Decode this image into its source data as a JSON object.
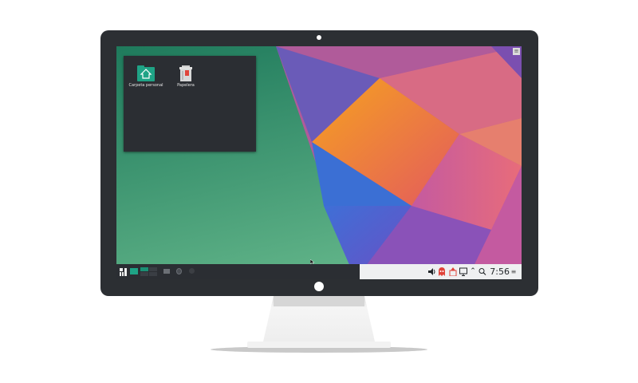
{
  "desktop": {
    "icons": [
      {
        "name": "home-folder-icon",
        "label": "Carpeta personal"
      },
      {
        "name": "trash-icon",
        "label": "Papelera"
      }
    ]
  },
  "panel": {
    "clock_time": "7:56"
  },
  "colors": {
    "monitor_bezel": "#2c2f33",
    "panel_bg": "#2b2e33",
    "tray_bg": "#eff0f1",
    "accent_green": "#1fa386",
    "accent_red": "#e0443a"
  }
}
